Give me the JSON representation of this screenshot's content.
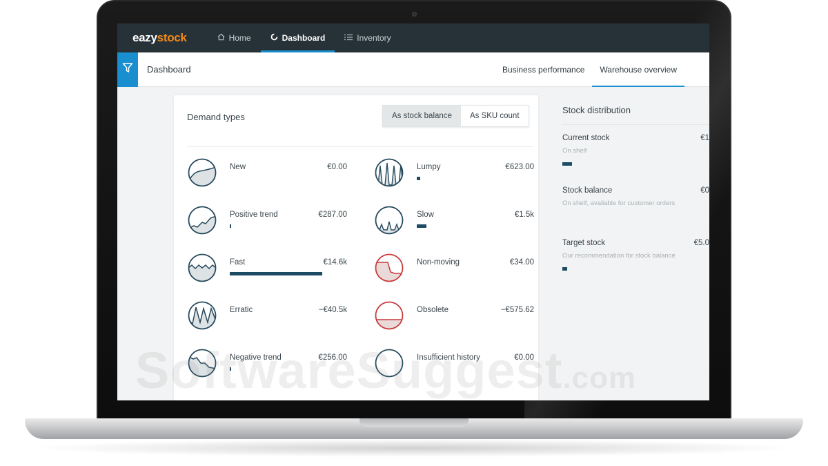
{
  "app": {
    "logo_part1": "eazy",
    "logo_part2": "stock",
    "accent_color": "#1a8fcf",
    "brand_orange": "#f08a1a"
  },
  "topnav": {
    "items": [
      {
        "label": "Home",
        "icon": "home-icon",
        "active": false
      },
      {
        "label": "Dashboard",
        "icon": "dashboard-icon",
        "active": true
      },
      {
        "label": "Inventory",
        "icon": "list-icon",
        "active": false
      }
    ]
  },
  "subheader": {
    "title": "Dashboard",
    "filter_icon": "filter-icon",
    "tabs": [
      {
        "label": "Business performance",
        "active": false
      },
      {
        "label": "Warehouse overview",
        "active": true
      }
    ]
  },
  "demand": {
    "title": "Demand types",
    "toggle": {
      "stock_balance": "As stock balance",
      "sku_count": "As SKU count",
      "selected": "As stock balance"
    },
    "left": [
      {
        "name": "New",
        "value": "€0.00",
        "bar": 0.0,
        "icon": "new-demand-icon"
      },
      {
        "name": "Positive trend",
        "value": "€287.00",
        "bar": 0.01,
        "icon": "positive-trend-icon"
      },
      {
        "name": "Fast",
        "value": "€14.6k",
        "bar": 0.79,
        "icon": "fast-demand-icon"
      },
      {
        "name": "Erratic",
        "value": "−€40.5k",
        "bar": 0.0,
        "icon": "erratic-demand-icon"
      },
      {
        "name": "Negative trend",
        "value": "€256.00",
        "bar": 0.01,
        "icon": "negative-trend-icon"
      }
    ],
    "right": [
      {
        "name": "Lumpy",
        "value": "€623.00",
        "bar": 0.03,
        "icon": "lumpy-demand-icon"
      },
      {
        "name": "Slow",
        "value": "€1.5k",
        "bar": 0.08,
        "icon": "slow-demand-icon"
      },
      {
        "name": "Non-moving",
        "value": "€34.00",
        "bar": 0.0,
        "icon": "non-moving-icon"
      },
      {
        "name": "Obsolete",
        "value": "−€575.62",
        "bar": 0.0,
        "icon": "obsolete-icon"
      },
      {
        "name": "Insufficient history",
        "value": "€0.00",
        "bar": 0.0,
        "icon": "insufficient-history-icon"
      }
    ]
  },
  "stock_distribution": {
    "title": "Stock distribution",
    "items": [
      {
        "name": "Current stock",
        "desc": "On shelf",
        "value": "€1",
        "bar": 0.08
      },
      {
        "name": "Stock balance",
        "desc": "On shelf, available for customer orders",
        "value": "€0",
        "bar": 0.0
      },
      {
        "name": "Target stock",
        "desc": "Our recommendation for stock balance",
        "value": "€5.0",
        "bar": 0.04
      }
    ]
  },
  "watermark": {
    "main": "SoftwareSuggest",
    "suffix": ".com"
  }
}
